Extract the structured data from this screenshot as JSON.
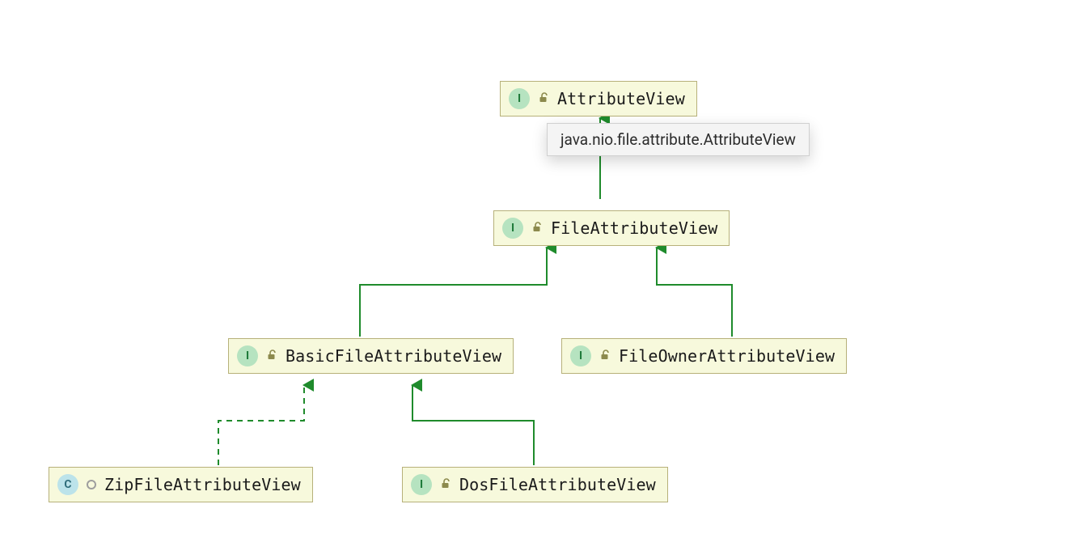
{
  "diagram": {
    "nodes": {
      "attributeView": {
        "label": "AttributeView",
        "type_letter": "I",
        "kind": "interface"
      },
      "fileAttributeView": {
        "label": "FileAttributeView",
        "type_letter": "I",
        "kind": "interface"
      },
      "basicFileAttributeView": {
        "label": "BasicFileAttributeView",
        "type_letter": "I",
        "kind": "interface"
      },
      "fileOwnerAttributeView": {
        "label": "FileOwnerAttributeView",
        "type_letter": "I",
        "kind": "interface"
      },
      "zipFileAttributeView": {
        "label": "ZipFileAttributeView",
        "type_letter": "C",
        "kind": "class"
      },
      "dosFileAttributeView": {
        "label": "DosFileAttributeView",
        "type_letter": "I",
        "kind": "interface"
      }
    },
    "tooltip": {
      "text": "java.nio.file.attribute.AttributeView"
    },
    "edges": [
      {
        "from": "fileAttributeView",
        "to": "attributeView",
        "style": "solid"
      },
      {
        "from": "basicFileAttributeView",
        "to": "fileAttributeView",
        "style": "solid"
      },
      {
        "from": "fileOwnerAttributeView",
        "to": "fileAttributeView",
        "style": "solid"
      },
      {
        "from": "dosFileAttributeView",
        "to": "basicFileAttributeView",
        "style": "solid"
      },
      {
        "from": "zipFileAttributeView",
        "to": "basicFileAttributeView",
        "style": "dashed"
      }
    ],
    "colors": {
      "node_fill": "#f7f9dc",
      "node_border": "#b7b17a",
      "edge": "#1f8b2c",
      "interface_badge": "#b6e3c0",
      "class_badge": "#bce3ea"
    }
  }
}
